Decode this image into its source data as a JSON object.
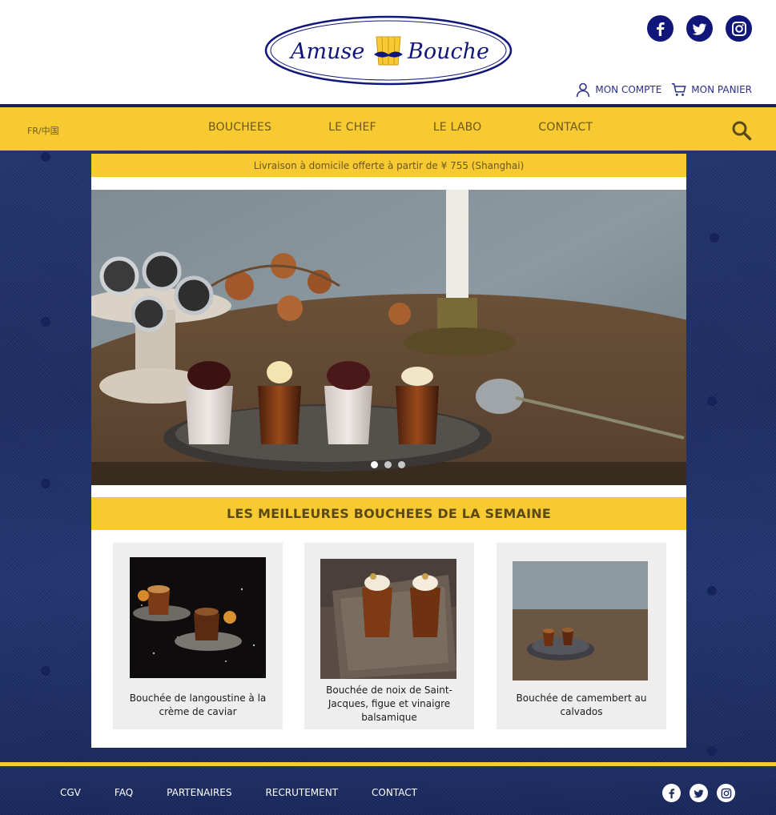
{
  "brand": {
    "name_left": "Amuse",
    "name_right": "Bouche",
    "color_primary": "#10167a",
    "color_accent": "#f8ca32"
  },
  "header": {
    "social": [
      {
        "icon": "facebook-icon"
      },
      {
        "icon": "twitter-icon"
      },
      {
        "icon": "instagram-icon"
      }
    ],
    "account_label": "MON COMPTE",
    "cart_label": "MON PANIER"
  },
  "nav": {
    "language": "FR/中国",
    "items": [
      "BOUCHEES",
      "LE CHEF",
      "LE LABO",
      "CONTACT"
    ],
    "search_icon": "search-icon"
  },
  "promo": {
    "text": "Livraison à domicile offerte à partir de ¥ 755 (Shanghai)"
  },
  "carousel": {
    "slide_count": 3,
    "active_slide": 1
  },
  "section": {
    "title": "LES MEILLEURES BOUCHEES DE LA SEMAINE"
  },
  "products": [
    {
      "name": "Bouchée de langoustine à la crème de caviar"
    },
    {
      "name": "Bouchée de noix de Saint-Jacques, figue et vinaigre balsamique"
    },
    {
      "name": "Bouchée de camembert au calvados"
    }
  ],
  "footer": {
    "links": [
      "CGV",
      "FAQ",
      "PARTENAIRES",
      "RECRUTEMENT",
      "CONTACT"
    ]
  }
}
